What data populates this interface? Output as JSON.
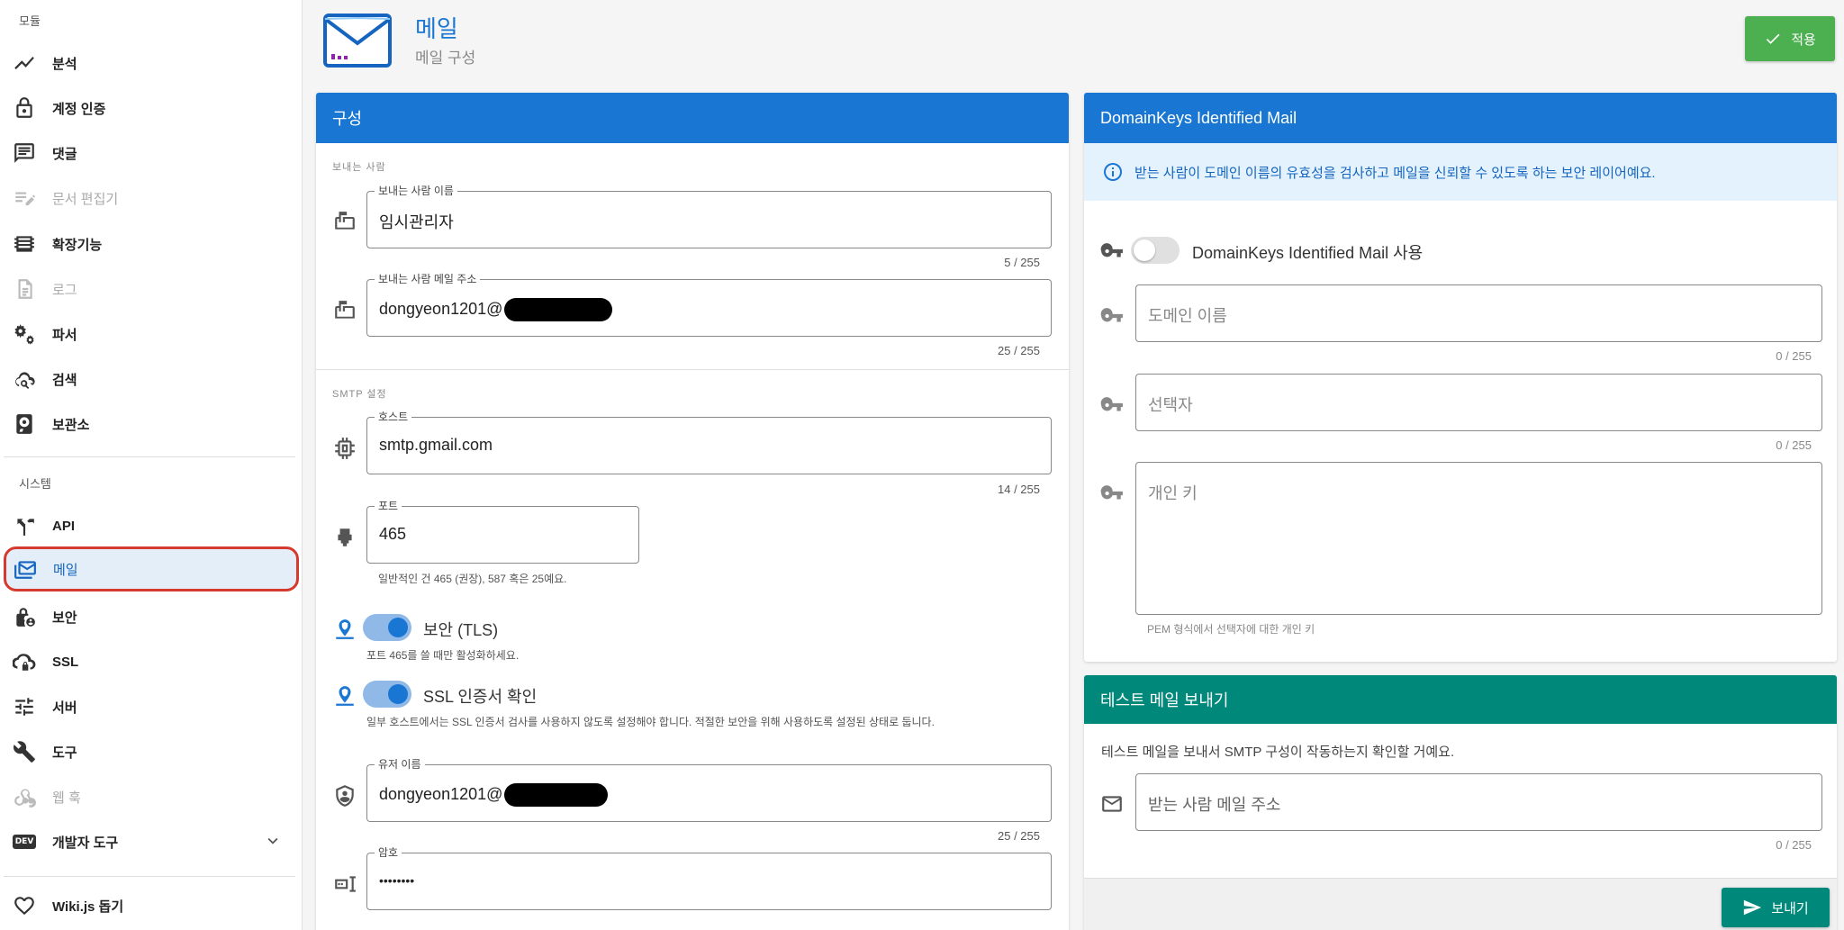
{
  "sidebar": {
    "modules_header": "모듈",
    "modules": [
      {
        "label": "분석",
        "icon": "analytics-icon"
      },
      {
        "label": "계정 인증",
        "icon": "lock-icon"
      },
      {
        "label": "댓글",
        "icon": "comment-icon"
      },
      {
        "label": "문서 편집기",
        "icon": "editor-icon"
      },
      {
        "label": "확장기능",
        "icon": "extension-icon"
      },
      {
        "label": "로그",
        "icon": "log-icon"
      },
      {
        "label": "파서",
        "icon": "gears-icon"
      },
      {
        "label": "검색",
        "icon": "search-cloud-icon"
      },
      {
        "label": "보관소",
        "icon": "storage-icon"
      }
    ],
    "system_header": "시스템",
    "system": [
      {
        "label": "API",
        "icon": "api-icon"
      },
      {
        "label": "메일",
        "icon": "mail-icon"
      },
      {
        "label": "보안",
        "icon": "security-lock-icon"
      },
      {
        "label": "SSL",
        "icon": "ssl-cloud-icon"
      },
      {
        "label": "서버",
        "icon": "sliders-icon"
      },
      {
        "label": "도구",
        "icon": "wrench-icon"
      },
      {
        "label": "웹 훅",
        "icon": "webhook-icon"
      },
      {
        "label": "개발자 도구",
        "badge": "DEV"
      }
    ],
    "donate": "Wiki.js 돕기"
  },
  "header": {
    "title": "메일",
    "subtitle": "메일 구성",
    "apply_label": "적용"
  },
  "config": {
    "title": "구성",
    "sender_section": "보내는 사람",
    "sender_name_label": "보내는 사람 이름",
    "sender_name_value": "임시관리자",
    "sender_name_counter": "5 / 255",
    "sender_email_label": "보내는 사람 메일 주소",
    "sender_email_value": "dongyeon1201@",
    "sender_email_counter": "25 / 255",
    "smtp_section": "SMTP 설정",
    "host_label": "호스트",
    "host_value": "smtp.gmail.com",
    "host_counter": "14 / 255",
    "port_label": "포트",
    "port_value": "465",
    "port_hint": "일반적인 건 465 (권장), 587 혹은 25예요.",
    "tls_label": "보안 (TLS)",
    "tls_hint": "포트 465를 쓸 때만 활성화하세요.",
    "tls_on": true,
    "ssl_label": "SSL 인증서 확인",
    "ssl_hint": "일부 호스트에서는 SSL 인증서 검사를 사용하지 않도록 설정해야 합니다. 적절한 보안을 위해 사용하도록 설정된 상태로 둡니다.",
    "ssl_on": true,
    "username_label": "유저 이름",
    "username_value": "dongyeon1201@",
    "username_counter": "25 / 255",
    "password_label": "암호",
    "password_value": "••••••••"
  },
  "dkim": {
    "title": "DomainKeys Identified Mail",
    "info": "받는 사람이 도메인 이름의 유효성을 검사하고 메일을 신뢰할 수 있도록 하는 보안 레이어예요.",
    "enable_label": "DomainKeys Identified Mail 사용",
    "enabled": false,
    "domain_placeholder": "도메인 이름",
    "domain_counter": "0 / 255",
    "selector_placeholder": "선택자",
    "selector_counter": "0 / 255",
    "private_key_placeholder": "개인 키",
    "private_key_hint": "PEM 형식에서 선택자에 대한 개인 키"
  },
  "test_mail": {
    "title": "테스트 메일 보내기",
    "description": "테스트 메일을 보내서 SMTP 구성이 작동하는지 확인할 거예요.",
    "recipient_placeholder": "받는 사람 메일 주소",
    "recipient_counter": "0 / 255",
    "send_label": "보내기"
  },
  "colors": {
    "primary": "#1976d2",
    "apply_green": "#4caf50",
    "teal": "#00897b",
    "highlight_red": "#d63a2f"
  }
}
